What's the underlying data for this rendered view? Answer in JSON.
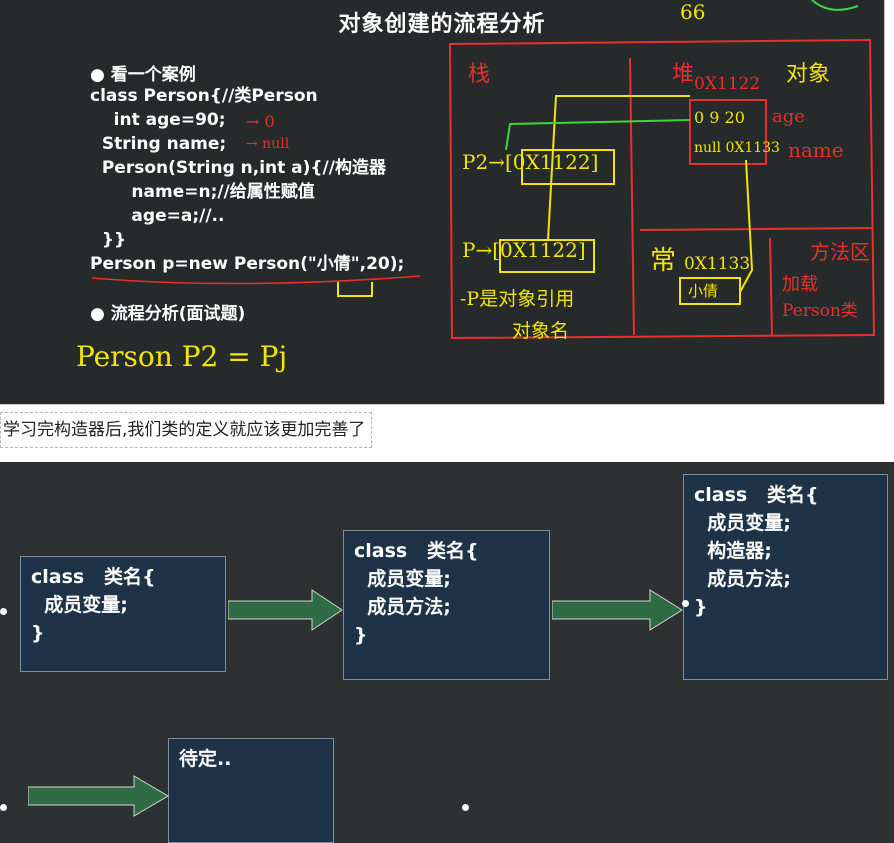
{
  "board": {
    "title": "对象创建的流程分析",
    "bullet1": "● 看一个案例",
    "code_lines": [
      "class Person{//类Person",
      "    int age=90;",
      "  String name;",
      "  Person(String n,int a){//构造器",
      "       name=n;//给属性赋值",
      "       age=a;//..",
      "  }}",
      "Person p=new Person(\"小倩\",20);"
    ],
    "bullet2": "● 流程分析(面试题)",
    "handwriting": {
      "top_number": "66",
      "stack_label": "栈",
      "heap_label": "堆",
      "object_label": "对象",
      "heap_addr": "0X1122",
      "age_value": "0 9 20",
      "age_label": "age",
      "name_value": "null 0X1133",
      "name_label": "name",
      "p2_ref": "P2→[0X1122]",
      "p_ref": "P→[0X1122]",
      "p_note1": "-P是对象引用",
      "p_note2": "对象名",
      "const_label": "常",
      "const_addr": "0X1133",
      "const_value": "小倩",
      "method_label": "方法区",
      "method_note1": "加载",
      "method_note2": "Person类",
      "bottom_eq": "Person P2 = Pj",
      "arrow_zero": "→ 0",
      "arrow_null": "→ null"
    },
    "colors": {
      "bg": "#262a2b",
      "red": "#e8302a",
      "yellow": "#f2e600",
      "green": "#3fd43f"
    }
  },
  "caption": "学习完构造器后,我们类的定义就应该更加完善了",
  "slide": {
    "boxes": [
      {
        "text": "class   类名{\n  成员变量;\n}"
      },
      {
        "text": "class   类名{\n  成员变量;\n  成员方法;\n}"
      },
      {
        "text": "class   类名{\n  成员变量;\n  构造器;\n  成员方法;\n}"
      },
      {
        "text": "待定.."
      }
    ],
    "colors": {
      "box_bg": "#1e3248",
      "arrow": "#2f6b45"
    }
  }
}
